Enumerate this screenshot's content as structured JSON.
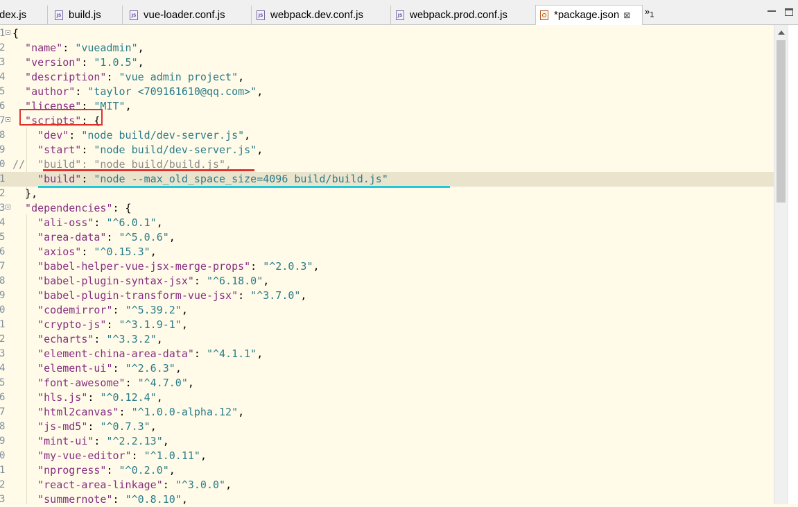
{
  "tabs": [
    {
      "label": "dex.js",
      "icon": "none",
      "active": false
    },
    {
      "label": "build.js",
      "icon": "js-file-icon",
      "active": false
    },
    {
      "label": "vue-loader.conf.js",
      "icon": "js-file-icon",
      "active": false
    },
    {
      "label": "webpack.dev.conf.js",
      "icon": "js-file-icon",
      "active": false
    },
    {
      "label": "webpack.prod.conf.js",
      "icon": "js-file-icon",
      "active": false
    },
    {
      "label": "*package.json",
      "icon": "json-file-icon",
      "active": true,
      "close": "⊠"
    }
  ],
  "overflow": {
    "chevron": "»",
    "count": "1"
  },
  "lines": [
    {
      "num": "1",
      "fold": true,
      "tokens": [
        {
          "t": "p",
          "v": "{"
        }
      ]
    },
    {
      "num": "2",
      "fold": false,
      "tokens": [
        {
          "t": "k",
          "v": "  \"name\""
        },
        {
          "t": "p",
          "v": ": "
        },
        {
          "t": "s",
          "v": "\"vueadmin\""
        },
        {
          "t": "p",
          "v": ","
        }
      ]
    },
    {
      "num": "3",
      "fold": false,
      "tokens": [
        {
          "t": "k",
          "v": "  \"version\""
        },
        {
          "t": "p",
          "v": ": "
        },
        {
          "t": "s",
          "v": "\"1.0.5\""
        },
        {
          "t": "p",
          "v": ","
        }
      ]
    },
    {
      "num": "4",
      "fold": false,
      "tokens": [
        {
          "t": "k",
          "v": "  \"description\""
        },
        {
          "t": "p",
          "v": ": "
        },
        {
          "t": "s",
          "v": "\"vue admin project\""
        },
        {
          "t": "p",
          "v": ","
        }
      ]
    },
    {
      "num": "5",
      "fold": false,
      "tokens": [
        {
          "t": "k",
          "v": "  \"author\""
        },
        {
          "t": "p",
          "v": ": "
        },
        {
          "t": "s",
          "v": "\"taylor <709161610@qq.com>\""
        },
        {
          "t": "p",
          "v": ","
        }
      ]
    },
    {
      "num": "6",
      "fold": false,
      "tokens": [
        {
          "t": "k",
          "v": "  \"license\""
        },
        {
          "t": "p",
          "v": ": "
        },
        {
          "t": "s",
          "v": "\"MIT\""
        },
        {
          "t": "p",
          "v": ","
        }
      ]
    },
    {
      "num": "7",
      "fold": true,
      "tokens": [
        {
          "t": "k",
          "v": "  \"scripts\""
        },
        {
          "t": "p",
          "v": ": {"
        }
      ]
    },
    {
      "num": "8",
      "fold": false,
      "tokens": [
        {
          "t": "k",
          "v": "    \"dev\""
        },
        {
          "t": "p",
          "v": ": "
        },
        {
          "t": "s",
          "v": "\"node build/dev-server.js\""
        },
        {
          "t": "p",
          "v": ","
        }
      ]
    },
    {
      "num": "9",
      "fold": false,
      "tokens": [
        {
          "t": "k",
          "v": "    \"start\""
        },
        {
          "t": "p",
          "v": ": "
        },
        {
          "t": "s",
          "v": "\"node build/dev-server.js\""
        },
        {
          "t": "p",
          "v": ","
        }
      ]
    },
    {
      "num": "0",
      "fold": false,
      "tokens": [
        {
          "t": "c",
          "v": "//  \"build\": \"node build/build.js\","
        }
      ]
    },
    {
      "num": "1",
      "fold": false,
      "current": true,
      "tokens": [
        {
          "t": "k",
          "v": "    \"build\""
        },
        {
          "t": "p",
          "v": ": "
        },
        {
          "t": "s",
          "v": "\"node --max_old_space_size=4096 build/build.js\""
        }
      ]
    },
    {
      "num": "2",
      "fold": false,
      "tokens": [
        {
          "t": "p",
          "v": "  },"
        }
      ]
    },
    {
      "num": "3",
      "fold": true,
      "tokens": [
        {
          "t": "k",
          "v": "  \"dependencies\""
        },
        {
          "t": "p",
          "v": ": {"
        }
      ]
    },
    {
      "num": "4",
      "fold": false,
      "tokens": [
        {
          "t": "k",
          "v": "    \"ali-oss\""
        },
        {
          "t": "p",
          "v": ": "
        },
        {
          "t": "s",
          "v": "\"^6.0.1\""
        },
        {
          "t": "p",
          "v": ","
        }
      ]
    },
    {
      "num": "5",
      "fold": false,
      "tokens": [
        {
          "t": "k",
          "v": "    \"area-data\""
        },
        {
          "t": "p",
          "v": ": "
        },
        {
          "t": "s",
          "v": "\"^5.0.6\""
        },
        {
          "t": "p",
          "v": ","
        }
      ]
    },
    {
      "num": "6",
      "fold": false,
      "tokens": [
        {
          "t": "k",
          "v": "    \"axios\""
        },
        {
          "t": "p",
          "v": ": "
        },
        {
          "t": "s",
          "v": "\"^0.15.3\""
        },
        {
          "t": "p",
          "v": ","
        }
      ]
    },
    {
      "num": "7",
      "fold": false,
      "tokens": [
        {
          "t": "k",
          "v": "    \"babel-helper-vue-jsx-merge-props\""
        },
        {
          "t": "p",
          "v": ": "
        },
        {
          "t": "s",
          "v": "\"^2.0.3\""
        },
        {
          "t": "p",
          "v": ","
        }
      ]
    },
    {
      "num": "8",
      "fold": false,
      "tokens": [
        {
          "t": "k",
          "v": "    \"babel-plugin-syntax-jsx\""
        },
        {
          "t": "p",
          "v": ": "
        },
        {
          "t": "s",
          "v": "\"^6.18.0\""
        },
        {
          "t": "p",
          "v": ","
        }
      ]
    },
    {
      "num": "9",
      "fold": false,
      "tokens": [
        {
          "t": "k",
          "v": "    \"babel-plugin-transform-vue-jsx\""
        },
        {
          "t": "p",
          "v": ": "
        },
        {
          "t": "s",
          "v": "\"^3.7.0\""
        },
        {
          "t": "p",
          "v": ","
        }
      ]
    },
    {
      "num": "0",
      "fold": false,
      "tokens": [
        {
          "t": "k",
          "v": "    \"codemirror\""
        },
        {
          "t": "p",
          "v": ": "
        },
        {
          "t": "s",
          "v": "\"^5.39.2\""
        },
        {
          "t": "p",
          "v": ","
        }
      ]
    },
    {
      "num": "1",
      "fold": false,
      "tokens": [
        {
          "t": "k",
          "v": "    \"crypto-js\""
        },
        {
          "t": "p",
          "v": ": "
        },
        {
          "t": "s",
          "v": "\"^3.1.9-1\""
        },
        {
          "t": "p",
          "v": ","
        }
      ]
    },
    {
      "num": "2",
      "fold": false,
      "tokens": [
        {
          "t": "k",
          "v": "    \"echarts\""
        },
        {
          "t": "p",
          "v": ": "
        },
        {
          "t": "s",
          "v": "\"^3.3.2\""
        },
        {
          "t": "p",
          "v": ","
        }
      ]
    },
    {
      "num": "3",
      "fold": false,
      "tokens": [
        {
          "t": "k",
          "v": "    \"element-china-area-data\""
        },
        {
          "t": "p",
          "v": ": "
        },
        {
          "t": "s",
          "v": "\"^4.1.1\""
        },
        {
          "t": "p",
          "v": ","
        }
      ]
    },
    {
      "num": "4",
      "fold": false,
      "tokens": [
        {
          "t": "k",
          "v": "    \"element-ui\""
        },
        {
          "t": "p",
          "v": ": "
        },
        {
          "t": "s",
          "v": "\"^2.6.3\""
        },
        {
          "t": "p",
          "v": ","
        }
      ]
    },
    {
      "num": "5",
      "fold": false,
      "tokens": [
        {
          "t": "k",
          "v": "    \"font-awesome\""
        },
        {
          "t": "p",
          "v": ": "
        },
        {
          "t": "s",
          "v": "\"^4.7.0\""
        },
        {
          "t": "p",
          "v": ","
        }
      ]
    },
    {
      "num": "6",
      "fold": false,
      "tokens": [
        {
          "t": "k",
          "v": "    \"hls.js\""
        },
        {
          "t": "p",
          "v": ": "
        },
        {
          "t": "s",
          "v": "\"^0.12.4\""
        },
        {
          "t": "p",
          "v": ","
        }
      ]
    },
    {
      "num": "7",
      "fold": false,
      "tokens": [
        {
          "t": "k",
          "v": "    \"html2canvas\""
        },
        {
          "t": "p",
          "v": ": "
        },
        {
          "t": "s",
          "v": "\"^1.0.0-alpha.12\""
        },
        {
          "t": "p",
          "v": ","
        }
      ]
    },
    {
      "num": "8",
      "fold": false,
      "tokens": [
        {
          "t": "k",
          "v": "    \"js-md5\""
        },
        {
          "t": "p",
          "v": ": "
        },
        {
          "t": "s",
          "v": "\"^0.7.3\""
        },
        {
          "t": "p",
          "v": ","
        }
      ]
    },
    {
      "num": "9",
      "fold": false,
      "tokens": [
        {
          "t": "k",
          "v": "    \"mint-ui\""
        },
        {
          "t": "p",
          "v": ": "
        },
        {
          "t": "s",
          "v": "\"^2.2.13\""
        },
        {
          "t": "p",
          "v": ","
        }
      ]
    },
    {
      "num": "0",
      "fold": false,
      "tokens": [
        {
          "t": "k",
          "v": "    \"my-vue-editor\""
        },
        {
          "t": "p",
          "v": ": "
        },
        {
          "t": "s",
          "v": "\"^1.0.11\""
        },
        {
          "t": "p",
          "v": ","
        }
      ]
    },
    {
      "num": "1",
      "fold": false,
      "tokens": [
        {
          "t": "k",
          "v": "    \"nprogress\""
        },
        {
          "t": "p",
          "v": ": "
        },
        {
          "t": "s",
          "v": "\"^0.2.0\""
        },
        {
          "t": "p",
          "v": ","
        }
      ]
    },
    {
      "num": "2",
      "fold": false,
      "tokens": [
        {
          "t": "k",
          "v": "    \"react-area-linkage\""
        },
        {
          "t": "p",
          "v": ": "
        },
        {
          "t": "s",
          "v": "\"^3.0.0\""
        },
        {
          "t": "p",
          "v": ","
        }
      ]
    },
    {
      "num": "3",
      "fold": false,
      "tokens": [
        {
          "t": "k",
          "v": "    \"summernote\""
        },
        {
          "t": "p",
          "v": ": "
        },
        {
          "t": "s",
          "v": "\"^0.8.10\""
        },
        {
          "t": "p",
          "v": ","
        }
      ]
    }
  ],
  "colors": {
    "key": "#862e81",
    "string": "#2a7c8a",
    "comment": "#8c8c8c",
    "annotation_red": "#e0302e",
    "annotation_cyan": "#20c8d8",
    "editor_bg": "#fffbe8",
    "current_line": "#ebe4cc"
  }
}
